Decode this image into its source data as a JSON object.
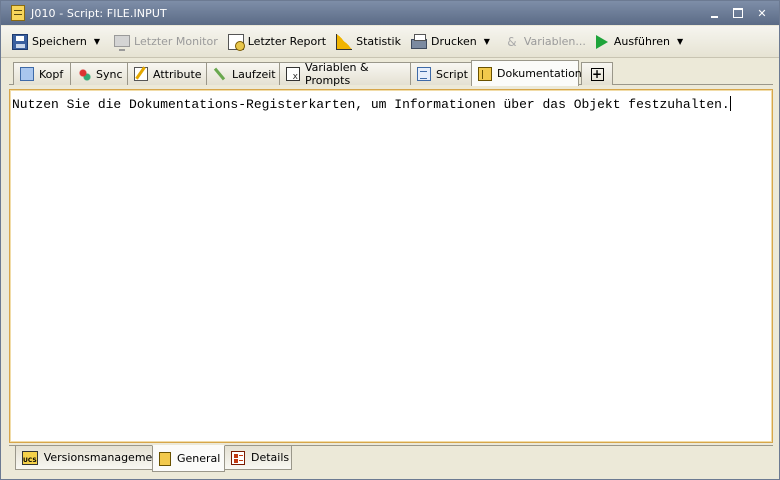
{
  "window": {
    "title": "J010 - Script: FILE.INPUT"
  },
  "toolbar": {
    "save_label": "Speichern",
    "last_monitor_label": "Letzter Monitor",
    "last_report_label": "Letzter Report",
    "statistics_label": "Statistik",
    "print_label": "Drucken",
    "variables_label": "Variablen...",
    "execute_label": "Ausführen"
  },
  "tabs": [
    {
      "label": "Kopf",
      "icon": "header-icon"
    },
    {
      "label": "Sync",
      "icon": "sync-icon"
    },
    {
      "label": "Attribute",
      "icon": "attributes-icon"
    },
    {
      "label": "Laufzeit",
      "icon": "runtime-icon"
    },
    {
      "label": "Variablen & Prompts",
      "icon": "variables-prompts-icon"
    },
    {
      "label": "Script",
      "icon": "script-icon"
    },
    {
      "label": "Dokumentation",
      "icon": "documentation-icon",
      "active": true
    }
  ],
  "editor": {
    "text": "Nutzen Sie die Dokumentations-Registerkarten, um Informationen über das Objekt festzuhalten."
  },
  "bottom_tabs": [
    {
      "label": "Versionsmanagement",
      "icon": "ucs-icon"
    },
    {
      "label": "General",
      "icon": "general-icon",
      "active": true
    },
    {
      "label": "Details",
      "icon": "details-icon"
    }
  ],
  "colors": {
    "titlebar": "#6b7b96",
    "panel_border": "#d7a64a",
    "execute_green": "#1ea43a"
  }
}
